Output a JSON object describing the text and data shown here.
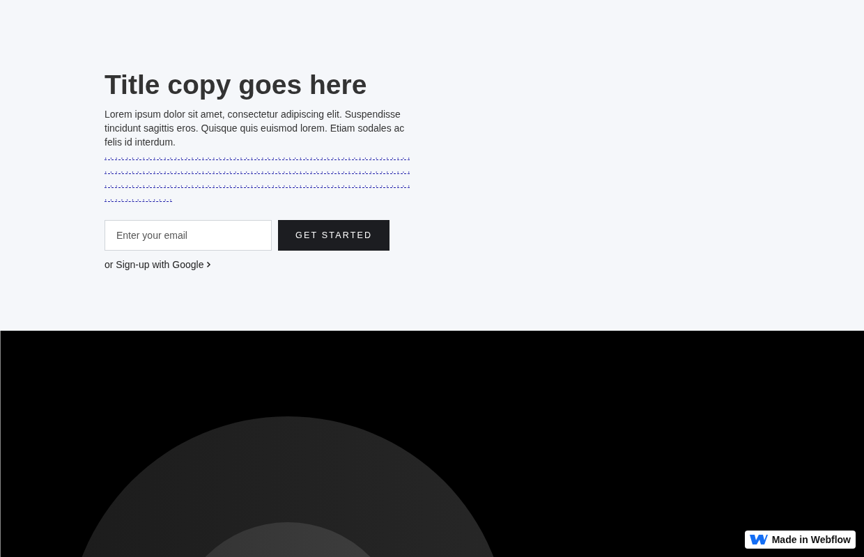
{
  "hero": {
    "title": "Title copy goes here",
    "body": "Lorem ipsum dolor sit amet, consectetur adipiscing elit. Suspendisse tincidunt sagittis eros. Quisque quis euismod lorem. Etiam sodales ac felis id interdum.",
    "links_text": ". . . . . . . . . . . . . . . . . . . . . . . . . . . . . . . . . . . . . . . . . . . . . . . . . . . . . . . . . . . . . . . . . . . . . . . . . . . . . . . . . . . . . . . . . . . . . . . . . . . . . . . . . . . . . . . . . . . . . . . . . . . . . . . . . . . . . . . . . . . . . . . . . . . . . . . . . . . . . . . . . . . . . . . . . . . . . . . . . . . . . . . .",
    "email": {
      "placeholder": "Enter your email"
    },
    "button": "GET STARTED",
    "google_link": "or Sign-up with Google"
  },
  "badge": {
    "label": "Made in Webflow"
  }
}
